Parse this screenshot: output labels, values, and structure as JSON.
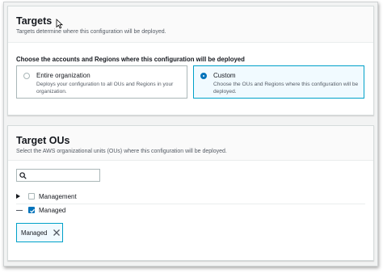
{
  "targets": {
    "title": "Targets",
    "description": "Targets determine where this configuration will be deployed.",
    "choose_label": "Choose the accounts and Regions where this configuration will be deployed",
    "options": [
      {
        "label": "Entire organization",
        "description": "Deploys your configuration to all OUs and Regions in your organization.",
        "selected": false
      },
      {
        "label": "Custom",
        "description": "Choose the OUs and Regions where this configuration will be deployed.",
        "selected": true
      }
    ]
  },
  "target_ous": {
    "title": "Target OUs",
    "description": "Select the AWS organizational units (OUs) where this configuration will be deployed.",
    "search": {
      "value": "",
      "placeholder": ""
    },
    "tree": [
      {
        "label": "Management",
        "checked": false,
        "expander": "collapsed"
      },
      {
        "label": "Managed",
        "checked": true,
        "expander": "none"
      }
    ],
    "selected_tokens": [
      {
        "label": "Managed"
      }
    ]
  },
  "colors": {
    "accent": "#0073bb",
    "selected_border": "#00a1c9",
    "selected_bg": "#f1faff"
  },
  "icons": [
    "search-icon",
    "caret-right-icon",
    "checkmark-icon",
    "close-icon",
    "mouse-cursor-icon"
  ]
}
